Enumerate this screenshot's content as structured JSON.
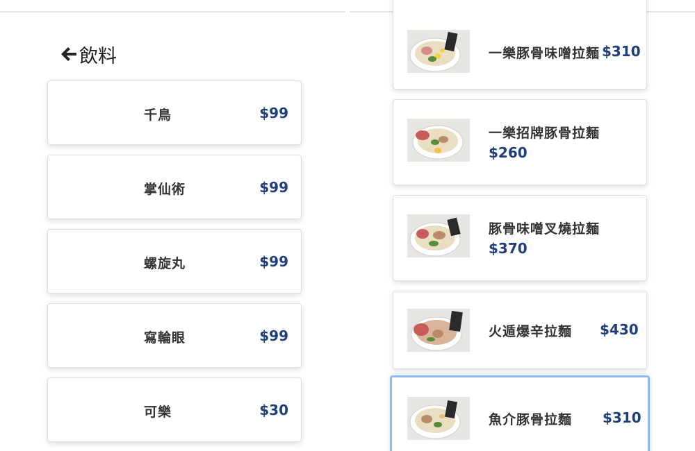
{
  "left_panel": {
    "header": {
      "title": "飲料",
      "back_icon": "arrow-left-icon"
    },
    "drinks": [
      {
        "name": "千鳥",
        "price": "$99"
      },
      {
        "name": "掌仙術",
        "price": "$99"
      },
      {
        "name": "螺旋丸",
        "price": "$99"
      },
      {
        "name": "寫輪眼",
        "price": "$99"
      },
      {
        "name": "可樂",
        "price": "$30"
      }
    ]
  },
  "right_panel": {
    "ramen": [
      {
        "name": "一樂豚骨味噌拉麵",
        "price": "$310"
      },
      {
        "name": "一樂招牌豚骨拉麵",
        "price": "$260"
      },
      {
        "name": "豚骨味噌叉燒拉麵",
        "price": "$370"
      },
      {
        "name": "火遁爆辛拉麵",
        "price": "$430"
      },
      {
        "name": "魚介豚骨拉麵",
        "price": "$310",
        "selected": true
      }
    ]
  },
  "colors": {
    "price": "#1e3f7a",
    "selected_border": "#8fb8ec",
    "card_border": "#dedede"
  }
}
